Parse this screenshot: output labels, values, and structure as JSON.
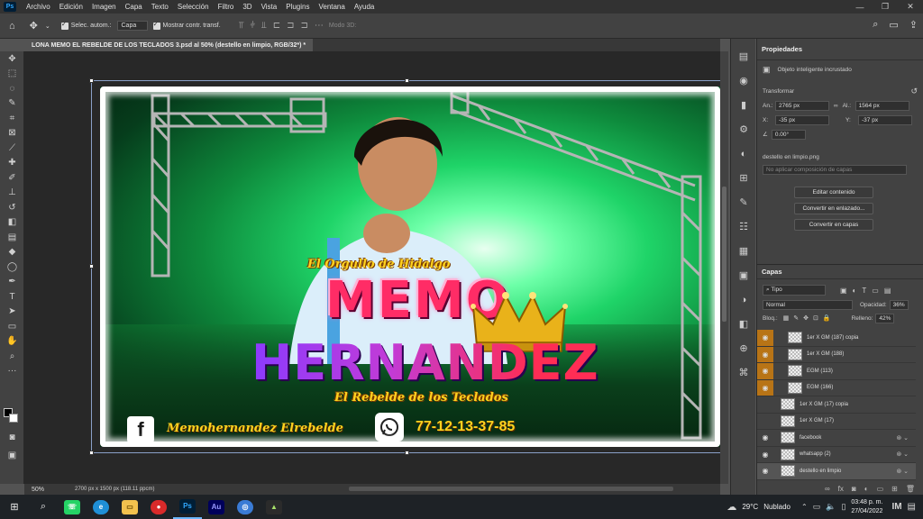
{
  "menu": {
    "app_icon": "Ps",
    "items": [
      "Archivo",
      "Edición",
      "Imagen",
      "Capa",
      "Texto",
      "Selección",
      "Filtro",
      "3D",
      "Vista",
      "Plugins",
      "Ventana",
      "Ayuda"
    ]
  },
  "options": {
    "auto_select_label": "Selec. autom.:",
    "auto_select_value": "Capa",
    "show_transform_label": "Mostrar contr. transf.",
    "mode_3d_label": "Modo 3D:"
  },
  "document": {
    "tab_title": "LONA MEMO EL REBELDE DE LOS TECLADOS 3.psd al 50% (destello en limpio, RGB/32*) *",
    "zoom": "50%",
    "doc_size": "2700 px x 1500 px (118.11 ppcm)"
  },
  "artwork": {
    "tagline": "El Orgullo de Hidalgo",
    "name_first": "MEMO",
    "name_last": "HERNANDEZ",
    "subtitle": "El Rebelde de los Teclados",
    "facebook_glyph": "f",
    "facebook_handle": "Memohernandez Elrebelde",
    "phone": "77-12-13-37-85"
  },
  "properties": {
    "title": "Propiedades",
    "object_type": "Objeto inteligente incrustado",
    "transform_label": "Transformar",
    "width_label": "An.:",
    "width_value": "2765 px",
    "height_label": "Al.:",
    "height_value": "1564 px",
    "x_label": "X:",
    "x_value": "-35 px",
    "y_label": "Y:",
    "y_value": "-37 px",
    "angle_value": "0.00°",
    "file_name": "destello en limpio.png",
    "layer_comp_placeholder": "No aplicar composición de capas",
    "btn_edit": "Editar contenido",
    "btn_linked": "Convertir en enlazado...",
    "btn_layers": "Convertir en capas"
  },
  "layers": {
    "title": "Capas",
    "filter_label": "Tipo",
    "blend_mode": "Normal",
    "opacity_label": "Opacidad:",
    "opacity_value": "36%",
    "lock_label": "Bloq.:",
    "fill_label": "Relleno:",
    "fill_value": "42%",
    "rows": [
      {
        "name": "1er X GM (187) copia",
        "gold": true,
        "eye": true
      },
      {
        "name": "1er X GM (188)",
        "gold": true,
        "eye": true
      },
      {
        "name": "EGM (113)",
        "gold": true,
        "eye": true
      },
      {
        "name": "EGM (166)",
        "gold": true,
        "eye": true
      },
      {
        "name": "1er X GM (17) copia",
        "gold": false,
        "eye": false
      },
      {
        "name": "1er X GM (17)",
        "gold": false,
        "eye": false
      },
      {
        "name": "facebook",
        "gold": false,
        "eye": true
      },
      {
        "name": "whatsapp (2)",
        "gold": false,
        "eye": true
      },
      {
        "name": "destello en limpio",
        "gold": false,
        "eye": true
      }
    ]
  },
  "taskbar": {
    "temperature": "29°C",
    "weather": "Nublado",
    "time": "03:48 p. m.",
    "date": "27/04/2022",
    "app_ps": "Ps",
    "app_au": "Au"
  },
  "colors": {
    "accent_gold": "#ffd21f",
    "layer_highlight": "#b87416",
    "panel_bg": "#424242"
  }
}
